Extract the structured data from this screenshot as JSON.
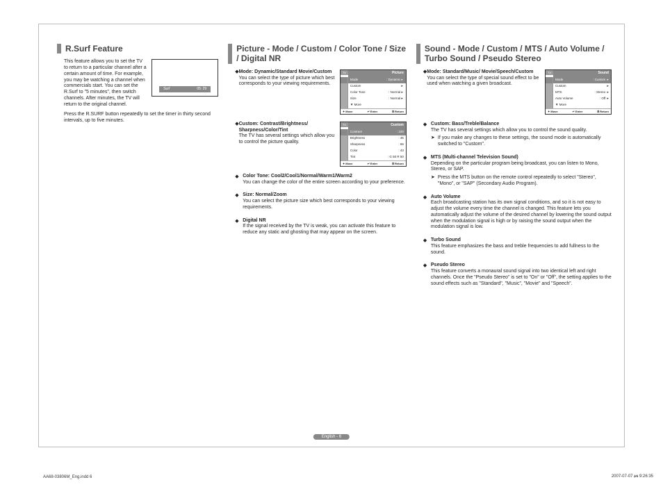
{
  "col1": {
    "title": "R.Surf Feature",
    "intro": "This feature allows you to set the TV to return to a particular channel after a certain amount of time. For example, you may be watching a channel when commercials start. You can set the R.Surf to \"5 minutes\", then switch channels. After minutes, the TV will return to the original channel.",
    "surf_label": "Surf",
    "surf_time": "05: 29",
    "press": "Press the R.SURF button repeatedly to set the timer in thirty second intervals, up to five minutes."
  },
  "col2": {
    "title": "Picture - Mode / Custom / Color Tone / Size / Digital NR",
    "items": [
      {
        "title": "Mode: Dynamic/Standard Movie/Custom",
        "body": "You can select the type of picture which best corresponds to your viewing requirements."
      },
      {
        "title": "Custom: Contrast/Brightness/ Sharpness/Color/Tint",
        "body": "The TV has several settings which allow you to control the picture quality."
      },
      {
        "title": "Color Tone: Cool2/Cool1/Normal/Warm1/Warm2",
        "body": "You can change the color of the entire screen according to your preference."
      },
      {
        "title": "Size: Normal/Zoom",
        "body": "You can select the picture size which best corresponds to your viewing requirements."
      },
      {
        "title": "Digital NR",
        "body": "If the signal received by the TV is weak, you can activate this feature to reduce any static and ghosting that may appear on the screen."
      }
    ],
    "osd1": {
      "header": "Picture",
      "rows": [
        {
          "label": "Mode",
          "value": ": Dynamic",
          "sel": true,
          "arrow": true
        },
        {
          "label": "Custom",
          "value": "",
          "arrow": true
        },
        {
          "label": "Color Tone",
          "value": ": Normal",
          "arrow": true
        },
        {
          "label": "Size",
          "value": ": Normal",
          "arrow": true
        },
        {
          "label": "▼ More",
          "value": ""
        }
      ]
    },
    "osd2": {
      "header": "Custom",
      "rows": [
        {
          "label": "Contrast",
          "value": ": 100",
          "sel": true
        },
        {
          "label": "Brightness",
          "value": ": 45"
        },
        {
          "label": "Sharpness",
          "value": ": 65"
        },
        {
          "label": "Color",
          "value": ": 43"
        },
        {
          "label": "Tint",
          "value": ": G 50   R 50"
        }
      ]
    },
    "footer": {
      "move": "Move",
      "enter": "Enter",
      "return": "Return"
    }
  },
  "col3": {
    "title": "Sound - Mode / Custom / MTS / Auto Volume / Turbo Sound / Pseudo Stereo",
    "item1": {
      "title": "Mode: Standard/Music/ Movie/Speech/Custom",
      "body": "You can select the type of special sound effect to be used when watching a given broadcast."
    },
    "osd3": {
      "header": "Sound",
      "rows": [
        {
          "label": "Mode",
          "value": ": Custom",
          "sel": true,
          "arrow": true
        },
        {
          "label": "Custom",
          "value": "",
          "arrow": true
        },
        {
          "label": "MTS",
          "value": ": Stereo",
          "arrow": true
        },
        {
          "label": "Auto Volume",
          "value": ": Off",
          "arrow": true
        },
        {
          "label": "▼ More",
          "value": ""
        }
      ]
    },
    "items": [
      {
        "title": "Custom: Bass/Treble/Balance",
        "body": "The TV has several settings which allow you to control the sound quality.",
        "sub": "If you make any changes to these settings, the sound mode is automatically switched to \"Custom\"."
      },
      {
        "title": "MTS (Multi-channel Television Sound)",
        "body": "Depending on the particular program being broadcast, you can listen to Mono, Stereo, or SAP.",
        "sub": "Press the MTS button on the remote control repeatedly to select \"Stereo\", \"Mono\", or \"SAP\" (Secondary Audio Program)."
      },
      {
        "title": "Auto Volume",
        "body": "Each broadcasting station has its own signal conditions, and so it is not easy to adjust the volume every time the channel is changed. This feature lets you automatically adjust the volume of the desired channel by lowering the sound output when the modulation signal is high or by raising the sound output when the modulation signal is low."
      },
      {
        "title": "Turbo Sound",
        "body": "This feature emphasizes the bass and treble frequencies to add fullness to the sound."
      },
      {
        "title": "Pseudo Stereo",
        "body": "This feature converts a monaural sound signal into two identical left and right channels. Once the \"Pseudo Stereo\" is set to \"On\" or \"Off\", the setting applies to the sound effects such as \"Standard\", \"Music\", \"Movie\" and \"Speech\"."
      }
    ]
  },
  "page_num": "English - 6",
  "footer_left": "AA68-03806M_Eng.indd   6",
  "footer_right": "2007-07-07   ፅፄ 9:26:35"
}
